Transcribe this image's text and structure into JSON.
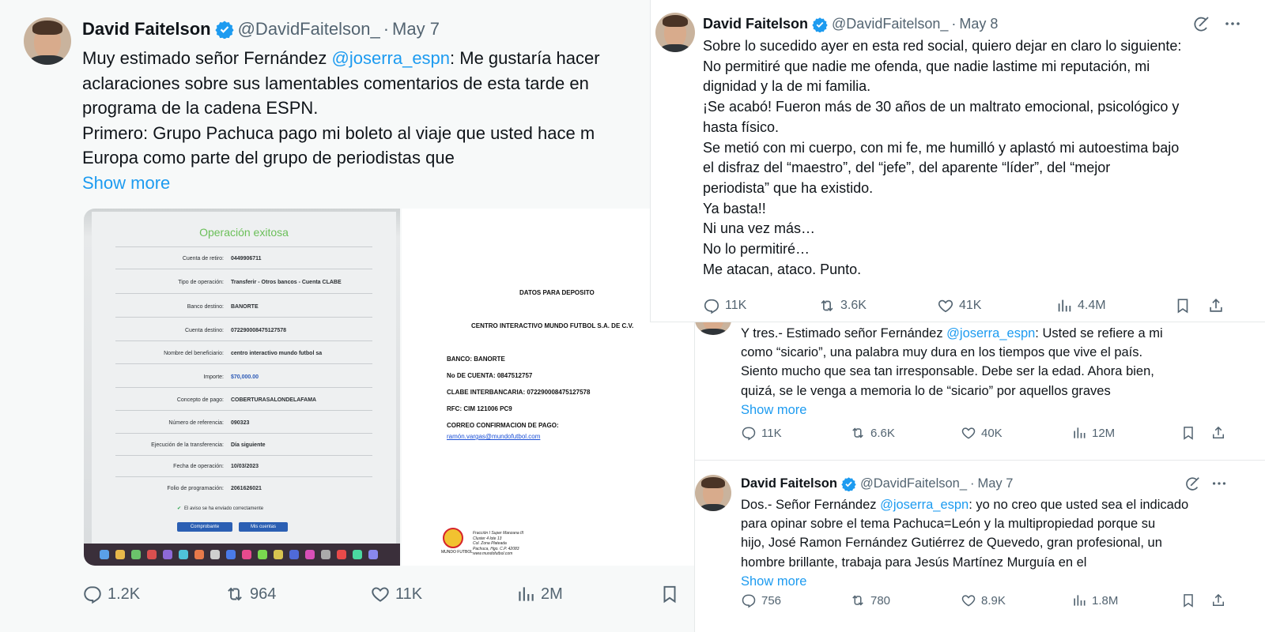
{
  "left": {
    "name": "David Faitelson",
    "handle": "@DavidFaitelson_",
    "date": "May 7",
    "body": [
      {
        "text": "Muy estimado señor Fernández ",
        "mention": "@joserra_espn",
        "after": ": Me gustaría hacer"
      },
      {
        "text": "aclaraciones sobre sus lamentables comentarios de esta tarde en"
      },
      {
        "text": "programa de la cadena ESPN."
      },
      {
        "text": "Primero: Grupo Pachuca pago mi boleto al viaje que usted hace m"
      },
      {
        "text": "Europa como parte del grupo de periodistas que"
      }
    ],
    "show_more": "Show more",
    "receipt": {
      "title": "Operación exitosa",
      "rows": [
        {
          "label": "Cuenta de retiro:",
          "value": "0449906711"
        },
        {
          "label": "Tipo de operación:",
          "value": "Transferir - Otros bancos - Cuenta CLABE"
        },
        {
          "label": "Banco destino:",
          "value": "BANORTE"
        },
        {
          "label": "Cuenta destino:",
          "value": "072290008475127578"
        },
        {
          "label": "Nombre del beneficiario:",
          "value": "centro interactivo mundo futbol sa"
        },
        {
          "label": "Importe:",
          "value": "$70,000.00"
        },
        {
          "label": "Concepto de pago:",
          "value": "COBERTURASALONDELAFAMA"
        },
        {
          "label": "Número de referencia:",
          "value": "090323"
        },
        {
          "label": "Ejecución de la transferencia:",
          "value": "Día siguiente"
        },
        {
          "label": "Fecha de operación:",
          "value": "10/03/2023"
        },
        {
          "label": "Folio de programación:",
          "value": "2061626021"
        }
      ],
      "confirm": "El aviso se ha enviado correctamente",
      "btn1": "Comprobante",
      "btn2": "Mis cuentas"
    },
    "deposit": {
      "title": "DATOS PARA DEPOSITO",
      "company": "CENTRO INTERACTIVO MUNDO FUTBOL S.A. DE C.V.",
      "bank": "BANCO: BANORTE",
      "account": "No DE CUENTA: 0847512757",
      "clabe": "CLABE INTERBANCARIA: 072290008475127578",
      "rfc": "RFC: CIM 121006 PC9",
      "email_label": "CORREO CONFIRMACION DE PAGO:",
      "email": "ramón.vargas@mundofutbol.com",
      "logo_text": "MUNDO FUTBOL",
      "address": [
        "Fracción I Super Manzana III",
        "Cluster 4 lote 13",
        "Col. Zona Plateada",
        "Pachuca, Hgo. C.P. 42083",
        "www.mundofutbol.com"
      ]
    },
    "stats": {
      "replies": "1.2K",
      "reposts": "964",
      "likes": "11K",
      "views": "2M"
    }
  },
  "top_right": {
    "name": "David Faitelson",
    "handle": "@DavidFaitelson_",
    "date": "May 8",
    "body": [
      "Sobre lo sucedido ayer en esta red social, quiero dejar en claro lo siguiente:",
      "No permitiré que nadie me ofenda, que nadie lastime mi reputación, mi",
      "dignidad y la de mi familia.",
      "¡Se acabó! Fueron más de 30 años de un maltrato emocional, psicológico y",
      "hasta físico.",
      "Se metió con mi cuerpo, con mi fe, me humilló y aplastó mi autoestima bajo",
      "el disfraz del “maestro”, del “jefe”, del aparente “líder”, del “mejor",
      "periodista” que ha existido.",
      "Ya basta!!",
      "Ni una vez más…",
      "No lo permitiré…",
      "Me atacan, ataco. Punto."
    ],
    "stats": {
      "replies": "11K",
      "reposts": "3.6K",
      "likes": "41K",
      "views": "4.4M"
    }
  },
  "middle": {
    "body": [
      {
        "text": "Y tres.- Estimado señor Fernández ",
        "mention": "@joserra_espn",
        "after": ": Usted se refiere a mi"
      },
      {
        "text": "como “sicario”, una palabra muy dura en los tiempos que vive el país."
      },
      {
        "text": "Siento mucho que sea tan irresponsable. Debe ser la edad. Ahora bien,"
      },
      {
        "text": "quizá, se le venga a memoria lo de “sicario” por aquellos graves"
      }
    ],
    "show_more": "Show more",
    "stats": {
      "replies": "11K",
      "reposts": "6.6K",
      "likes": "40K",
      "views": "12M"
    }
  },
  "bottom": {
    "name": "David Faitelson",
    "handle": "@DavidFaitelson_",
    "date": "May 7",
    "body": [
      {
        "text": "Dos.- Señor Fernández ",
        "mention": "@joserra_espn",
        "after": ": yo no creo que usted sea el indicado"
      },
      {
        "text": "para opinar sobre el tema Pachuca=León y la multipropiedad porque su"
      },
      {
        "text": "hijo, José Ramon Fernández Gutiérrez de Quevedo, gran profesional, un"
      },
      {
        "text": "hombre brillante, trabaja para Jesús Martínez Murguía en el"
      }
    ],
    "show_more": "Show more",
    "stats": {
      "replies": "756",
      "reposts": "780",
      "likes": "8.9K",
      "views": "1.8M"
    }
  },
  "colors": {
    "accent": "#1d9bf0",
    "muted": "#536471",
    "text": "#0f1419",
    "success": "#6bbf59"
  }
}
